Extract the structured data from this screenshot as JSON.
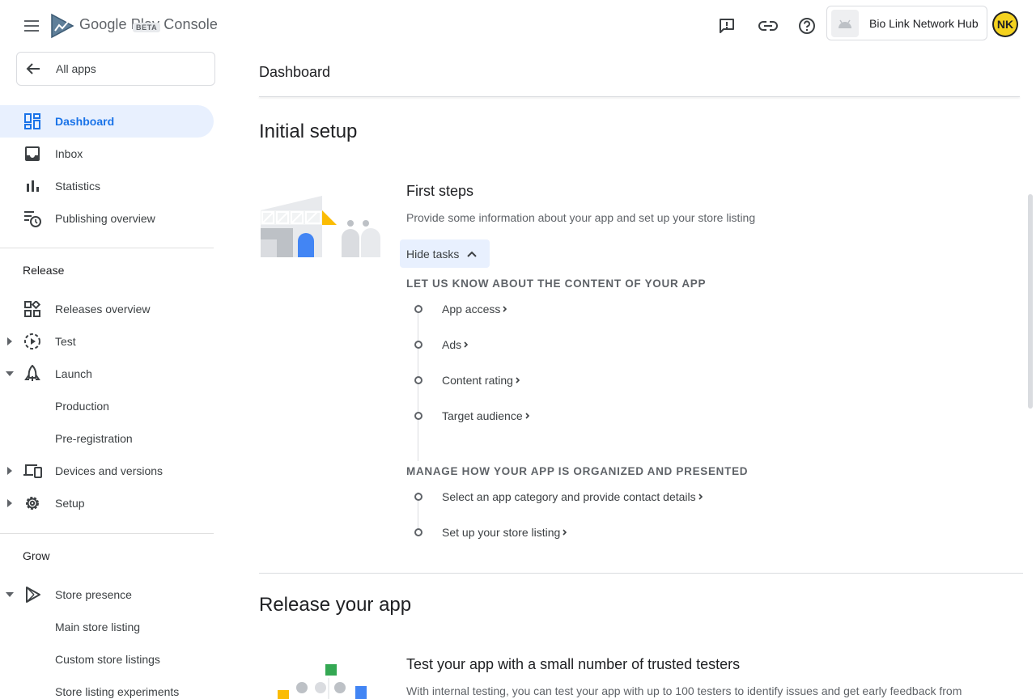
{
  "header": {
    "product_name": "Google Play Console",
    "beta_badge": "BETA",
    "app_name": "Bio Link Network Hub",
    "avatar_initials": "NK"
  },
  "sidebar": {
    "all_apps_label": "All apps",
    "top_items": [
      {
        "label": "Dashboard",
        "icon": "dashboard-icon",
        "active": true
      },
      {
        "label": "Inbox",
        "icon": "inbox-icon"
      },
      {
        "label": "Statistics",
        "icon": "bar-chart-icon"
      },
      {
        "label": "Publishing overview",
        "icon": "publishing-overview-icon"
      }
    ],
    "release": {
      "heading": "Release",
      "items": [
        {
          "label": "Releases overview",
          "icon": "releases-overview-icon"
        },
        {
          "label": "Test",
          "icon": "test-icon",
          "caret": "right"
        },
        {
          "label": "Launch",
          "icon": "launch-icon",
          "caret": "down"
        },
        {
          "label": "Production"
        },
        {
          "label": "Pre-registration"
        },
        {
          "label": "Devices and versions",
          "icon": "devices-icon",
          "caret": "right"
        },
        {
          "label": "Setup",
          "icon": "gear-icon",
          "caret": "right"
        }
      ]
    },
    "grow": {
      "heading": "Grow",
      "items": [
        {
          "label": "Store presence",
          "icon": "store-presence-icon",
          "caret": "down"
        },
        {
          "label": "Main store listing"
        },
        {
          "label": "Custom store listings"
        },
        {
          "label": "Store listing experiments"
        }
      ]
    }
  },
  "main": {
    "page_title": "Dashboard",
    "initial_setup": {
      "heading": "Initial setup",
      "card_title": "First steps",
      "card_desc": "Provide some information about your app and set up your store listing",
      "hide_tasks_label": "Hide tasks",
      "groups": [
        {
          "heading": "LET US KNOW ABOUT THE CONTENT OF YOUR APP",
          "tasks": [
            "App access",
            "Ads",
            "Content rating",
            "Target audience"
          ]
        },
        {
          "heading": "MANAGE HOW YOUR APP IS ORGANIZED AND PRESENTED",
          "tasks": [
            "Select an app category and provide contact details",
            "Set up your store listing"
          ]
        }
      ]
    },
    "release_app": {
      "heading": "Release your app",
      "card_title": "Test your app with a small number of trusted testers",
      "card_desc": "With internal testing, you can test your app with up to 100 testers to identify issues and get early feedback from"
    }
  },
  "colors": {
    "accent": "#1a73e8",
    "active_bg": "#e8f0fe",
    "text_primary": "#202124",
    "text_secondary": "#5f6368"
  }
}
